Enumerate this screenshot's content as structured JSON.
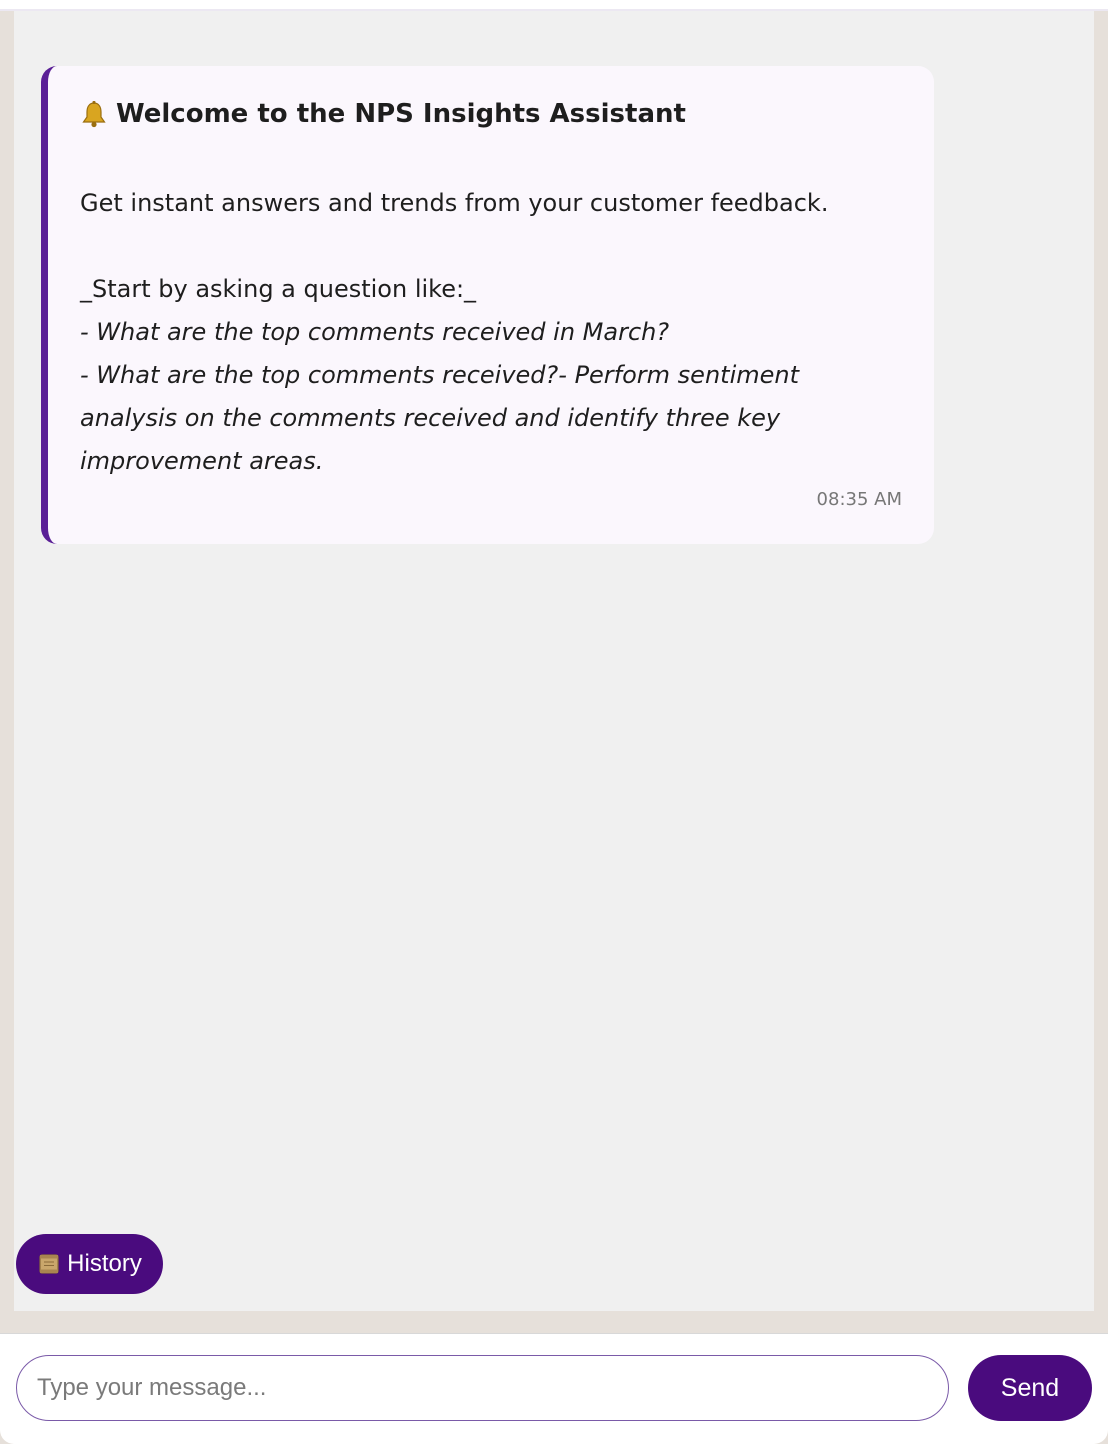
{
  "message": {
    "icon": "bell-icon",
    "title": "Welcome to the NPS Insights Assistant",
    "intro": "Get instant answers and trends from your customer feedback.",
    "prompt": "_Start by asking a question like:_",
    "examples": [
      "- What are the top comments received in March?",
      "- What are the top comments received?- Perform sentiment analysis on the comments received and identify three key improvement areas."
    ],
    "time": "08:35 AM"
  },
  "history": {
    "icon": "scroll-icon",
    "label": "History"
  },
  "composer": {
    "placeholder": "Type your message...",
    "value": "",
    "send_label": "Send"
  },
  "colors": {
    "accent": "#4a0b7e",
    "card_border": "#5a1f96",
    "card_background": "#fbf7fd",
    "chat_background": "#f0f0f0"
  }
}
